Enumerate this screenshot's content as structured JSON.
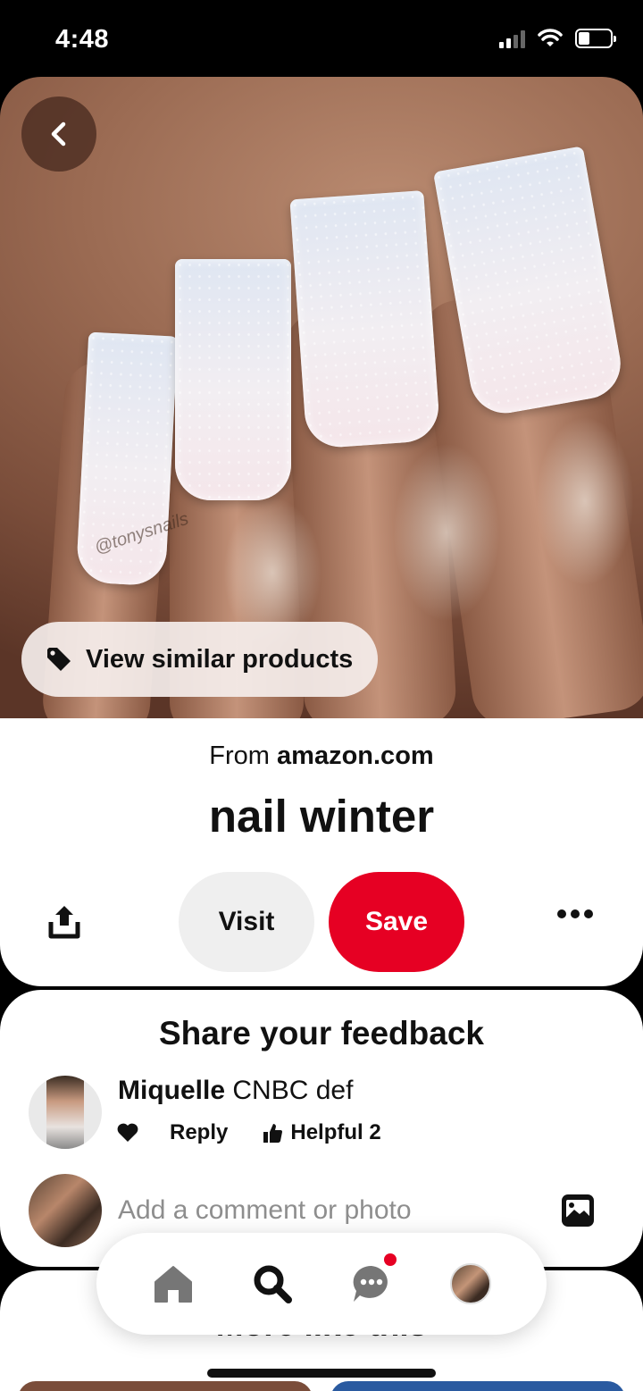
{
  "status_bar": {
    "time": "4:48"
  },
  "hero": {
    "watermark": "@tonysnails",
    "similar_products_label": "View similar products"
  },
  "pin": {
    "source_prefix": "From",
    "source_domain": "amazon.com",
    "title": "nail winter",
    "visit_label": "Visit",
    "save_label": "Save"
  },
  "feedback": {
    "title": "Share your feedback",
    "comment": {
      "author": "Miquelle",
      "text": "CNBC def",
      "reply_label": "Reply",
      "helpful_label": "Helpful 2"
    },
    "add_comment_placeholder": "Add a comment or photo"
  },
  "more": {
    "title": "More like this"
  },
  "nav": {
    "items": [
      "home-icon",
      "search-icon",
      "messages-icon",
      "profile-avatar"
    ],
    "has_message_notification": true
  },
  "colors": {
    "save_red": "#e60023",
    "visit_gray": "#efefef"
  }
}
